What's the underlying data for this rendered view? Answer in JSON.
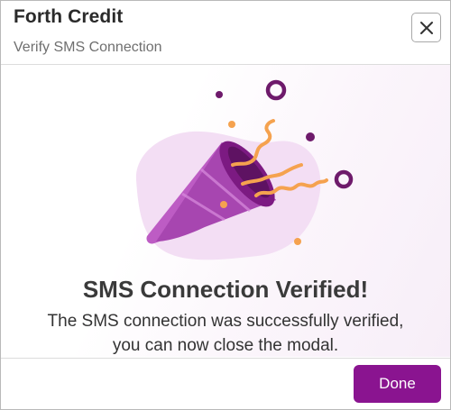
{
  "header": {
    "title": "Forth Credit",
    "subtitle": "Verify SMS Connection",
    "close_icon": "close-icon"
  },
  "content": {
    "illustration": "party-popper-illustration",
    "heading": "SMS Connection Verified!",
    "message_line1": "The SMS connection was successfully verified,",
    "message_line2": "you can now close the modal."
  },
  "footer": {
    "done_label": "Done"
  },
  "colors": {
    "accent": "#8a1490",
    "confetti_orange": "#f5a24f",
    "confetti_purple": "#6e1a6b",
    "blob": "#f3def4"
  }
}
